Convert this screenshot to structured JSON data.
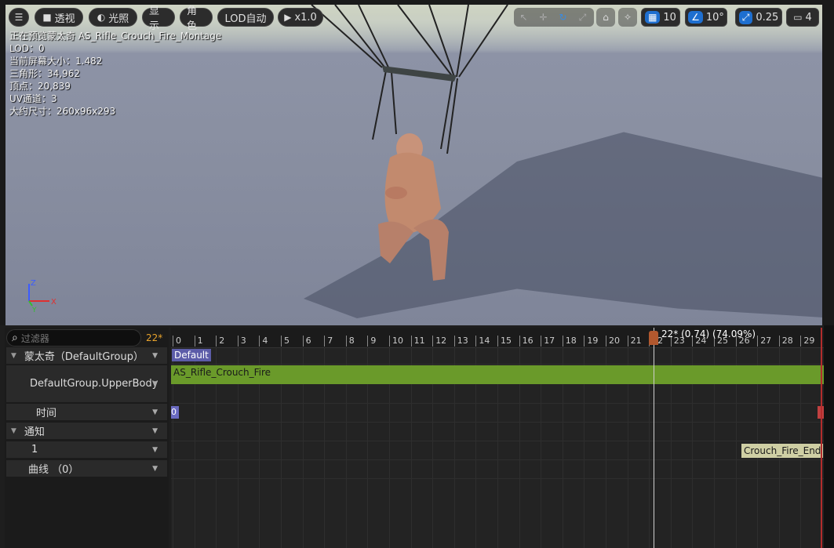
{
  "toolbar": {
    "menu_icon": "hamburger-icon",
    "perspective": "透视",
    "lighting": "光照",
    "show": "显示",
    "character": "角色",
    "lod": "LOD自动",
    "play_speed": "x1.0",
    "grid_size": "10",
    "rotation_snap": "10°",
    "scale_snap": "0.25",
    "camera_speed": "4"
  },
  "info": {
    "preview": "正在预览蒙太奇 AS_Rifle_Crouch_Fire_Montage",
    "lod": "LOD：0",
    "screen_size": "当前屏幕大小：1.482",
    "triangles": "三角形：34,962",
    "vertices": "顶点：20,839",
    "uv_channels": "UV通道：3",
    "approx_size": "大约尺寸：260x96x293"
  },
  "axes": {
    "z": "Z",
    "y": "Y",
    "x": "X"
  },
  "left_panel": {
    "filter_placeholder": "过滤器",
    "frame_count": "22*",
    "montage": "蒙太奇（DefaultGroup）",
    "slot": "DefaultGroup.UpperBody",
    "time": "时间",
    "notify": "通知",
    "notify_track": "1",
    "curves": "曲线  （0）"
  },
  "timeline": {
    "ticks": [
      "0",
      "1",
      "2",
      "3",
      "4",
      "5",
      "6",
      "7",
      "8",
      "9",
      "10",
      "11",
      "12",
      "13",
      "14",
      "15",
      "16",
      "17",
      "18",
      "19",
      "20",
      "21",
      "22",
      "23",
      "24",
      "25",
      "26",
      "27",
      "28",
      "29"
    ],
    "playhead_label": "22* (0.74) (74.09%)",
    "section": "Default",
    "segment": "AS_Rifle_Crouch_Fire",
    "start_marker": "0",
    "notify_event": "Crouch_Fire_End"
  },
  "colors": {
    "accent": "#1e6fd0",
    "segment": "#6a9a2a",
    "playhead": "#b2582e",
    "end": "#b32c2c"
  }
}
